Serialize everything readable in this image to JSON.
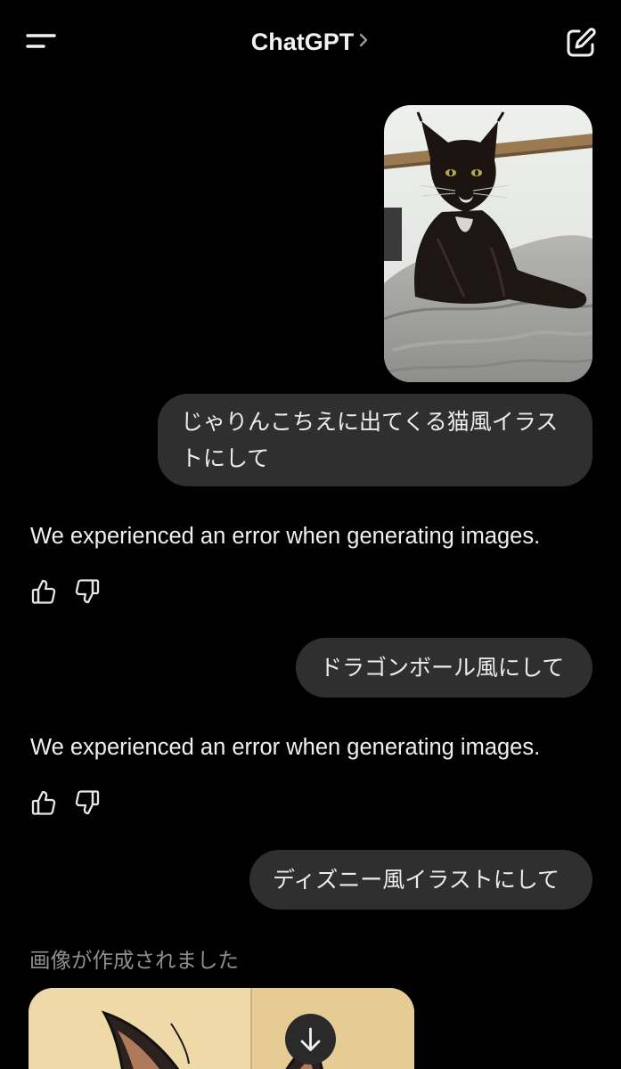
{
  "header": {
    "title": "ChatGPT",
    "menu_icon": "menu-icon",
    "title_chevron_icon": "chevron-right-icon",
    "compose_icon": "new-chat-icon"
  },
  "messages": [
    {
      "role": "user",
      "type": "image",
      "image": "black-cat-on-blanket-photo"
    },
    {
      "role": "user",
      "type": "text",
      "text": "じゃりんこちえに出てくる猫風イラストにして"
    },
    {
      "role": "assistant",
      "type": "text",
      "text": "We experienced an error when generating images."
    },
    {
      "role": "user",
      "type": "text",
      "text": "ドラゴンボール風にして"
    },
    {
      "role": "assistant",
      "type": "text",
      "text": "We experienced an error when generating images."
    },
    {
      "role": "user",
      "type": "text",
      "text": "ディズニー風イラストにして"
    },
    {
      "role": "assistant",
      "type": "status",
      "text": "画像が作成されました"
    }
  ],
  "feedback_icons": [
    "thumbs-up-icon",
    "thumbs-down-icon"
  ],
  "scroll_button_icon": "arrow-down-icon",
  "colors": {
    "background": "#000000",
    "bubble": "#2f2f2f",
    "text": "#ececec",
    "muted_text": "#8e8e8e"
  }
}
